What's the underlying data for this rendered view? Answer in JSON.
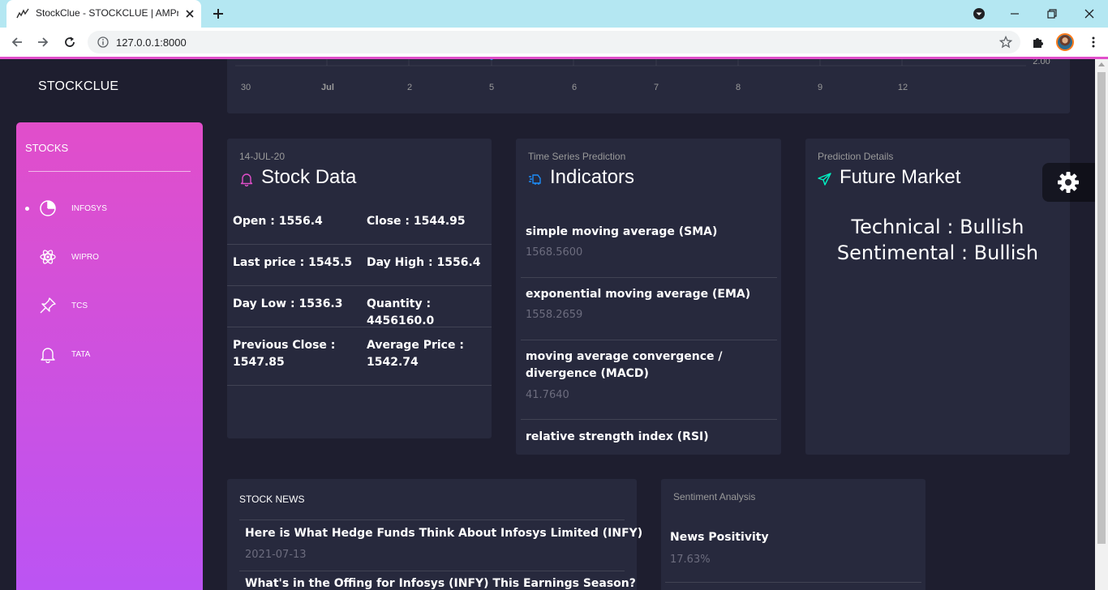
{
  "browser": {
    "tab_title": "StockClue - STOCKCLUE | AMPra",
    "url": "127.0.0.1:8000",
    "icons": [
      "stockclue-favicon-icon",
      "close-icon",
      "plus-icon",
      "back-icon",
      "forward-icon",
      "reload-icon",
      "info-icon",
      "star-icon",
      "puzzle-icon",
      "kebab-menu-icon",
      "chrome-media-icon",
      "minimize-icon",
      "restore-icon",
      "window-close-icon"
    ]
  },
  "brand": "STOCKCLUE",
  "sidebar": {
    "title": "STOCKS",
    "items": [
      {
        "label": "INFOSYS",
        "icon": "pie-chart-icon",
        "active": true
      },
      {
        "label": "WIPRO",
        "icon": "atom-icon",
        "active": false
      },
      {
        "label": "TCS",
        "icon": "pin-icon",
        "active": false
      },
      {
        "label": "TATA",
        "icon": "bell-icon",
        "active": false
      }
    ]
  },
  "chart": {
    "x_ticks": [
      "30",
      "Jul",
      "2",
      "5",
      "6",
      "7",
      "8",
      "9",
      "12"
    ],
    "y_label": "2.00"
  },
  "stock_data": {
    "date": "14-JUL-20",
    "title": "Stock Data",
    "rows": [
      [
        {
          "k": "Open :",
          "v": "1556.4"
        },
        {
          "k": "Close :",
          "v": "1544.95"
        }
      ],
      [
        {
          "k": "Last price :",
          "v": "1545.5"
        },
        {
          "k": "Day High :",
          "v": "1556.4"
        }
      ],
      [
        {
          "k": "Day Low :",
          "v": "1536.3"
        },
        {
          "k": "Quantity :",
          "v": "4456160.0"
        }
      ],
      [
        {
          "k": "Previous Close :",
          "v": "1547.85"
        },
        {
          "k": "Average Price :",
          "v": "1542.74"
        }
      ]
    ]
  },
  "indicators": {
    "category": "Time Series Prediction",
    "title": "Indicators",
    "items": [
      {
        "name": "simple moving average (SMA)",
        "value": "1568.5600"
      },
      {
        "name": "exponential moving average (EMA)",
        "value": "1558.2659"
      },
      {
        "name": "moving average convergence / divergence (MACD)",
        "name_line1": "moving average convergence /",
        "name_line2": "divergence (MACD)",
        "value": "41.7640"
      },
      {
        "name": "relative strength index (RSI)",
        "value": ""
      }
    ]
  },
  "future": {
    "category": "Prediction Details",
    "title": "Future Market",
    "technical": "Technical : Bullish",
    "sentimental": "Sentimental : Bullish"
  },
  "news": {
    "title": "STOCK NEWS",
    "items": [
      {
        "headline": "Here is What Hedge Funds Think About Infosys Limited (INFY)",
        "date": "2021-07-13"
      },
      {
        "headline": "What's in the Offing for Infosys (INFY) This Earnings Season?",
        "date": ""
      }
    ]
  },
  "sentiment": {
    "category": "Sentiment Analysis",
    "name": "News Positivity",
    "value": "17.63%"
  },
  "colors": {
    "accent": "#e14eca",
    "accent2": "#ba54f5",
    "background": "#1e1e2f",
    "card": "#27293d",
    "bullish_icon": "#00f2c3",
    "indicator_icon": "#1d8cf8"
  }
}
